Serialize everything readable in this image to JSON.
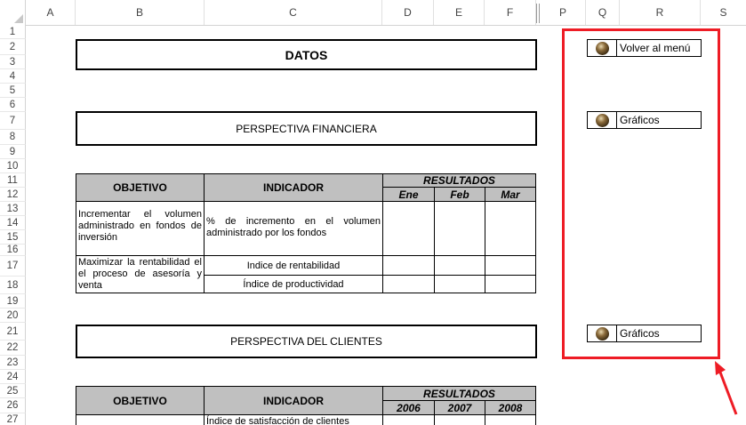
{
  "columns": [
    "A",
    "B",
    "C",
    "D",
    "E",
    "F",
    "P",
    "Q",
    "R",
    "S"
  ],
  "rows": [
    "1",
    "2",
    "3",
    "4",
    "5",
    "6",
    "7",
    "8",
    "9",
    "10",
    "11",
    "12",
    "13",
    "14",
    "15",
    "16",
    "17",
    "18",
    "19",
    "20",
    "21",
    "22",
    "23",
    "24",
    "25",
    "26",
    "27"
  ],
  "titles": {
    "datos": "DATOS",
    "financiera": "PERSPECTIVA FINANCIERA",
    "clientes": "PERSPECTIVA DEL CLIENTES"
  },
  "table1": {
    "objetivo": "OBJETIVO",
    "indicador": "INDICADOR",
    "resultados": "RESULTADOS",
    "months": [
      "Ene",
      "Feb",
      "Mar"
    ],
    "row1": {
      "objetivo": "Incrementar el volumen administrado en fondos de inversión",
      "indicador": "% de incremento en el volumen administrado por los fondos"
    },
    "row2": {
      "objetivo": "Maximizar la rentabilidad el el proceso de asesoría y venta",
      "indicador_a": "Indice de rentabilidad",
      "indicador_b": "Índice de productividad"
    }
  },
  "table2": {
    "objetivo": "OBJETIVO",
    "indicador": "INDICADOR",
    "resultados": "RESULTADOS",
    "years": [
      "2006",
      "2007",
      "2008"
    ],
    "row1_indicador": "Índice de satisfacción de clientes"
  },
  "buttons": {
    "menu": "Volver al menú",
    "graficos1": "Gráficos",
    "graficos2": "Gráficos"
  },
  "colors": {
    "highlight": "#ee1c25",
    "header_fill": "#c0c0c0"
  }
}
